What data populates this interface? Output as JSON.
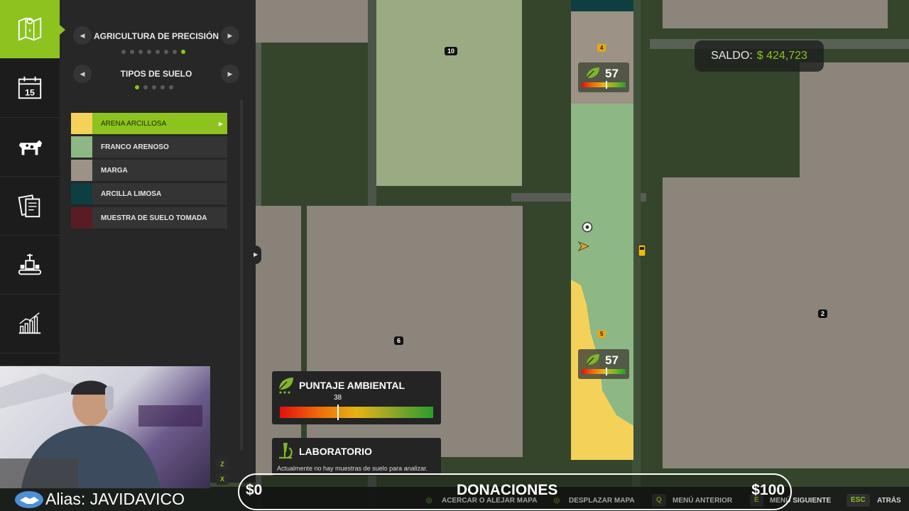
{
  "sidebar": {
    "items": [
      {
        "name": "map",
        "icon": "map-icon",
        "active": true
      },
      {
        "name": "calendar",
        "icon": "calendar-icon",
        "badge": "15"
      },
      {
        "name": "animals",
        "icon": "cow-icon"
      },
      {
        "name": "contracts",
        "icon": "contracts-icon"
      },
      {
        "name": "production",
        "icon": "production-icon"
      },
      {
        "name": "statistics",
        "icon": "chart-icon"
      }
    ]
  },
  "panel": {
    "section1": {
      "title": "AGRICULTURA DE PRECISIÓN",
      "dots": 8,
      "active_dot": 8
    },
    "section2": {
      "title": "TIPOS DE SUELO",
      "dots": 5,
      "active_dot": 1
    },
    "legend": [
      {
        "label": "ARENA ARCILLOSA",
        "color": "#f4d25a",
        "selected": true
      },
      {
        "label": "FRANCO ARENOSO",
        "color": "#8db785"
      },
      {
        "label": "MARGA",
        "color": "#9c9286"
      },
      {
        "label": "ARCILLA LIMOSA",
        "color": "#0e3d42"
      },
      {
        "label": "MUESTRA DE SUELO TOMADA",
        "color": "#5a1c24"
      }
    ],
    "prev_icon": "chevron-left-icon",
    "next_icon": "chevron-right-icon"
  },
  "map": {
    "field_ids": [
      "10",
      "6",
      "2"
    ],
    "field_numbers": [
      "4",
      "5"
    ],
    "scores": [
      {
        "value": "57",
        "level": 0.57
      },
      {
        "value": "57",
        "level": 0.57
      }
    ]
  },
  "saldo": {
    "label": "SALDO:",
    "amount": "$ 424,723"
  },
  "puntaje": {
    "title": "PUNTAJE AMBIENTAL",
    "value": "38",
    "level": 0.38
  },
  "laboratorio": {
    "title": "LABORATORIO",
    "text": "Actualmente no hay muestras de suelo para analizar."
  },
  "footer": {
    "hints": [
      {
        "key": "",
        "label": "ACERCAR O ALEJAR MAPA"
      },
      {
        "key": "",
        "label": "DESPLAZAR MAPA"
      },
      {
        "key": "Q",
        "label": "MENÚ ANTERIOR"
      },
      {
        "key": "E",
        "label": "MENÚ SIGUIENTE"
      },
      {
        "key": "ESC",
        "label": "ATRÁS"
      }
    ],
    "zoom_keys": [
      "Z",
      "X"
    ]
  },
  "overlay": {
    "donaciones": {
      "min": "$0",
      "title": "DONACIONES",
      "max": "$100"
    },
    "alias": "Alias: JAVIDAVICO"
  },
  "colors": {
    "accent": "#8cc31e",
    "panel": "#262726",
    "rail": "#1b1c1b"
  }
}
